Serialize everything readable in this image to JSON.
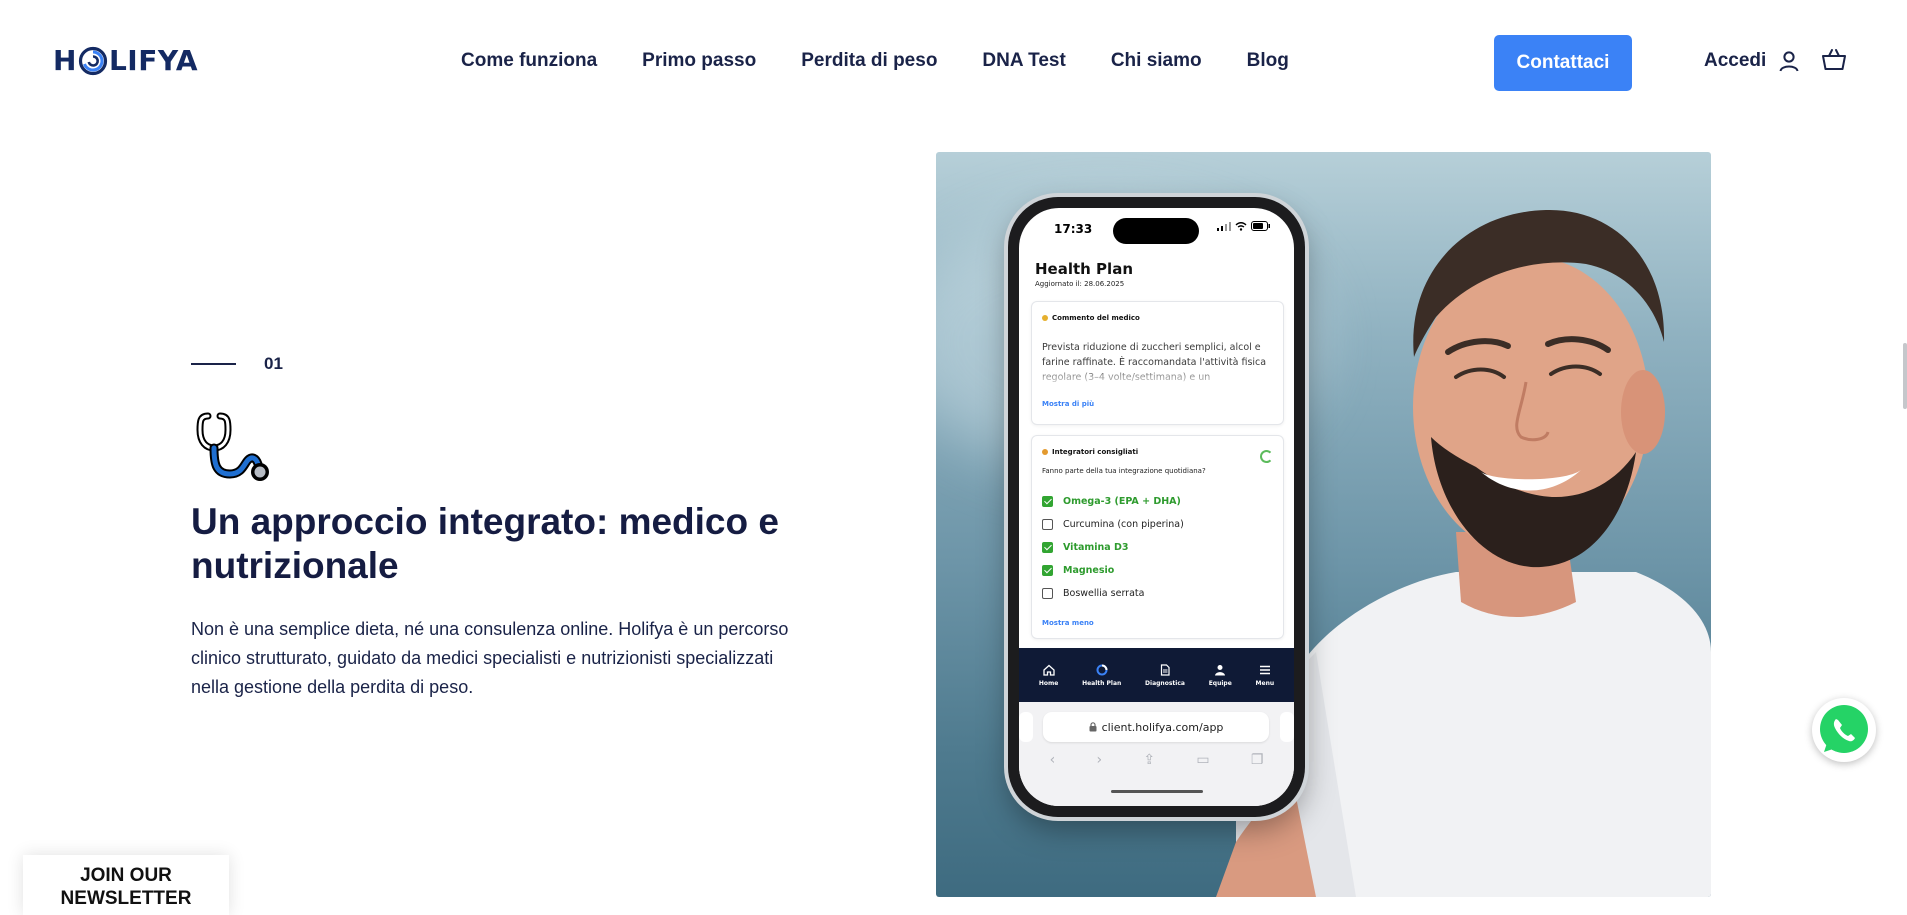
{
  "brand": {
    "logo_pre": "H",
    "logo_post": "LIFYA",
    "accent": "#3b82f6",
    "navy": "#142a63"
  },
  "nav": {
    "items": [
      "Come funziona",
      "Primo passo",
      "Perdita di peso",
      "DNA Test",
      "Chi siamo",
      "Blog"
    ]
  },
  "header": {
    "cta_label": "Contattaci",
    "login_label": "Accedi"
  },
  "section": {
    "step_number": "01",
    "title": "Un approccio integrato: medico e nutrizionale",
    "description": "Non è una semplice dieta, né una consulenza online. Holifya è un percorso clinico strutturato, guidato da medici specialisti e nutrizionisti specializzati nella gestione della perdita di peso."
  },
  "phone": {
    "time": "17:33",
    "title": "Health Plan",
    "updated": "Aggiornato il: 28.06.2025",
    "comment_card": {
      "heading": "Commento del medico",
      "text": "Prevista riduzione di zuccheri semplici, alcol e farine raffinate. È raccomandata l'attività fisica regolare (3–4 volte/settimana) e un",
      "more": "Mostra di più"
    },
    "supplements_card": {
      "heading": "Integratori consigliati",
      "question": "Fanno parte della tua integrazione quotidiana?",
      "items": [
        {
          "label": "Omega-3 (EPA + DHA)",
          "checked": true
        },
        {
          "label": "Curcumina (con piperina)",
          "checked": false
        },
        {
          "label": "Vitamina D3",
          "checked": true
        },
        {
          "label": "Magnesio",
          "checked": true
        },
        {
          "label": "Boswellia serrata",
          "checked": false
        }
      ],
      "less": "Mostra meno"
    },
    "tabs": [
      "Home",
      "Health Plan",
      "Diagnostica",
      "Equipe",
      "Menu"
    ],
    "url": "client.holifya.com/app"
  },
  "newsletter": {
    "line1": "JOIN OUR",
    "line2": "NEWSLETTER"
  },
  "icons": [
    "user-icon",
    "cart-icon",
    "stethoscope-icon",
    "whatsapp-icon",
    "lock-icon"
  ]
}
